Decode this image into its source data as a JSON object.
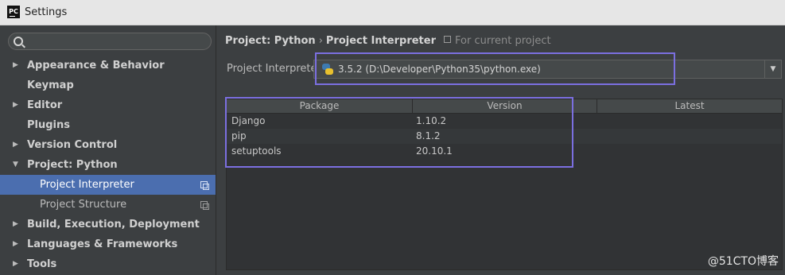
{
  "window": {
    "title": "Settings",
    "app_icon": "PC"
  },
  "sidebar": {
    "search": {
      "placeholder": ""
    },
    "items": [
      {
        "label": "Appearance & Behavior",
        "expandable": true,
        "expanded": false
      },
      {
        "label": "Keymap",
        "expandable": false
      },
      {
        "label": "Editor",
        "expandable": true,
        "expanded": false
      },
      {
        "label": "Plugins",
        "expandable": false
      },
      {
        "label": "Version Control",
        "expandable": true,
        "expanded": false
      },
      {
        "label": "Project: Python",
        "expandable": true,
        "expanded": true
      },
      {
        "label": "Project Interpreter",
        "child": true,
        "selected": true
      },
      {
        "label": "Project Structure",
        "child": true
      },
      {
        "label": "Build, Execution, Deployment",
        "expandable": true,
        "expanded": false
      },
      {
        "label": "Languages & Frameworks",
        "expandable": true,
        "expanded": false
      },
      {
        "label": "Tools",
        "expandable": true,
        "expanded": false
      }
    ]
  },
  "main": {
    "breadcrumb": {
      "parent": "Project: Python",
      "separator": "›",
      "current": "Project Interpreter",
      "scope": "For current project"
    },
    "interpreter": {
      "label": "Project Interpreter:",
      "value": "3.5.2 (D:\\Developer\\Python35\\python.exe)"
    },
    "table": {
      "columns": [
        "Package",
        "Version",
        "Latest"
      ],
      "rows": [
        {
          "package": "Django",
          "version": "1.10.2",
          "latest": ""
        },
        {
          "package": "pip",
          "version": "8.1.2",
          "latest": ""
        },
        {
          "package": "setuptools",
          "version": "20.10.1",
          "latest": ""
        }
      ]
    }
  },
  "watermark": "@51CTO博客",
  "colors": {
    "background": "#3c3f41",
    "selection": "#4b6eaf",
    "highlight_box": "#7b6fe0"
  }
}
